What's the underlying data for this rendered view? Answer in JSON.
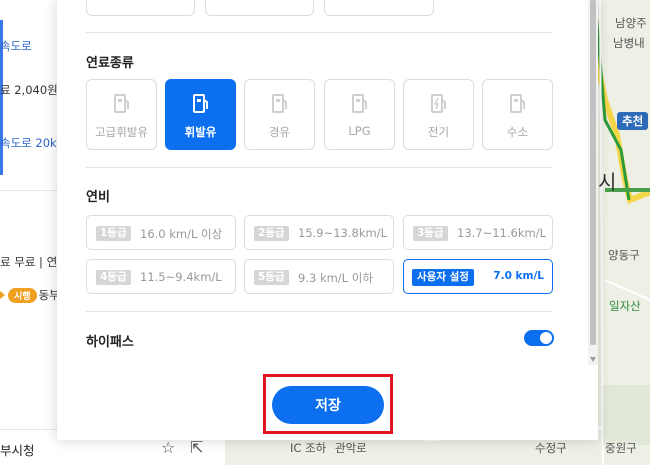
{
  "background_list": {
    "item1_road": "속도로",
    "item1_toll": "료 2,040원",
    "item2_road": "속도로 20km",
    "item3_info": "료 무료 | 연",
    "item3_tag": "시행",
    "item3_road": "동부",
    "bottom_place": "부시청"
  },
  "background_map": {
    "labels": [
      "남양주",
      "남병내",
      "추천",
      "시",
      "양동구",
      "일자산",
      "관악로",
      "수정구",
      "중원구",
      "IC 조하"
    ]
  },
  "fuel_section": {
    "title": "연료종류",
    "options": [
      {
        "label": "고급휘발유",
        "icon": "gas-pump-icon",
        "selected": false
      },
      {
        "label": "휘발유",
        "icon": "gas-pump-icon",
        "selected": true
      },
      {
        "label": "경유",
        "icon": "gas-pump-icon",
        "selected": false
      },
      {
        "label": "LPG",
        "icon": "gas-pump-icon",
        "selected": false
      },
      {
        "label": "전기",
        "icon": "ev-charger-icon",
        "selected": false
      },
      {
        "label": "수소",
        "icon": "gas-pump-icon",
        "selected": false
      }
    ]
  },
  "efficiency_section": {
    "title": "연비",
    "grades": [
      {
        "badge": "1등급",
        "value": "16.0 km/L 이상"
      },
      {
        "badge": "2등급",
        "value": "15.9~13.8km/L"
      },
      {
        "badge": "3등급",
        "value": "13.7~11.6km/L"
      },
      {
        "badge": "4등급",
        "value": "11.5~9.4km/L"
      },
      {
        "badge": "5등급",
        "value": "9.3 km/L 이하"
      },
      {
        "badge": "사용자 설정",
        "value": "7.0 km/L",
        "selected": true
      }
    ]
  },
  "hipass": {
    "label": "하이패스",
    "enabled": true
  },
  "save_button": {
    "label": "저장"
  },
  "colors": {
    "accent": "#0b6ff0",
    "highlight_box": "#e0141e"
  }
}
